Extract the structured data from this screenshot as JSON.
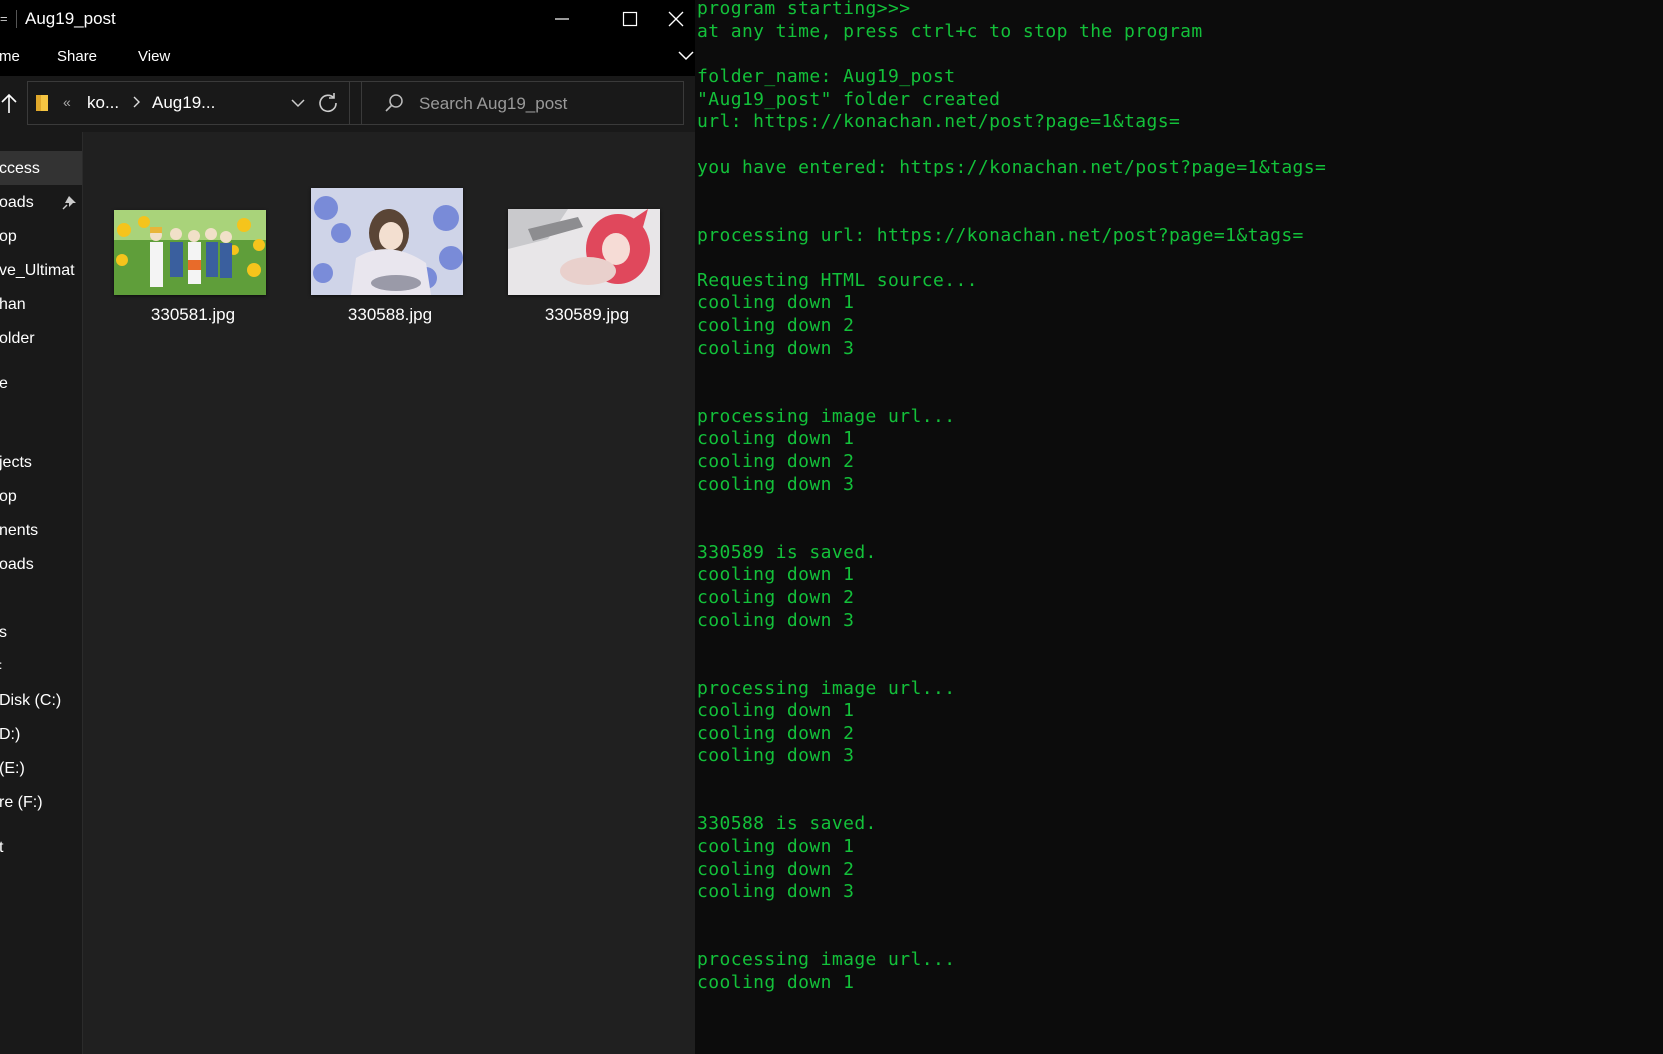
{
  "explorer": {
    "title": "Aug19_post",
    "ribbon": {
      "home": "me",
      "share": "Share",
      "view": "View",
      "help": "?"
    },
    "address": {
      "overflow": "«",
      "crumb1": "ko...",
      "crumb2": "Aug19..."
    },
    "search": {
      "placeholder": "Search Aug19_post"
    },
    "nav_items": [
      "ccess",
      "oads",
      "op",
      "ve_Ultimat",
      "han",
      "older",
      "e",
      "jects",
      "op",
      "nents",
      "oads",
      "s",
      "Disk (C:)",
      "D:)",
      "(E:)",
      "re (F:)",
      "t"
    ],
    "files": [
      {
        "name": "330581.jpg"
      },
      {
        "name": "330588.jpg"
      },
      {
        "name": "330589.jpg"
      }
    ]
  },
  "terminal": {
    "lines": [
      "program starting>>>",
      "at any time, press ctrl+c to stop the program",
      "",
      "folder_name: Aug19_post",
      "\"Aug19_post\" folder created",
      "url: https://konachan.net/post?page=1&tags=",
      "",
      "you have entered: https://konachan.net/post?page=1&tags=",
      "",
      "",
      "processing url: https://konachan.net/post?page=1&tags=",
      "",
      "Requesting HTML source...",
      "cooling down 1",
      "cooling down 2",
      "cooling down 3",
      "",
      "",
      "processing image url...",
      "cooling down 1",
      "cooling down 2",
      "cooling down 3",
      "",
      "",
      "330589 is saved.",
      "cooling down 1",
      "cooling down 2",
      "cooling down 3",
      "",
      "",
      "processing image url...",
      "cooling down 1",
      "cooling down 2",
      "cooling down 3",
      "",
      "",
      "330588 is saved.",
      "cooling down 1",
      "cooling down 2",
      "cooling down 3",
      "",
      "",
      "processing image url...",
      "cooling down 1"
    ],
    "color": "#13c13a"
  }
}
